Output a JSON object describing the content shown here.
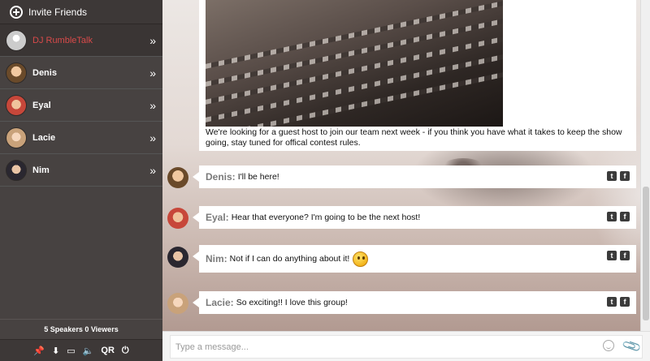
{
  "sidebar": {
    "invite_label": "Invite Friends",
    "users": [
      {
        "name": "DJ RumbleTalk",
        "active": true,
        "avatar_color": "#dcdcdc"
      },
      {
        "name": "Denis",
        "active": false,
        "avatar_color": "#d9a066"
      },
      {
        "name": "Eyal",
        "active": false,
        "avatar_color": "#cf5a45"
      },
      {
        "name": "Lacie",
        "active": false,
        "avatar_color": "#e4c3a0"
      },
      {
        "name": "Nim",
        "active": false,
        "avatar_color": "#2c2a2e"
      }
    ],
    "chevron": "»",
    "status": "5 Speakers 0 Viewers",
    "tools": [
      {
        "name": "pin-icon",
        "glyph": "📌"
      },
      {
        "name": "download-icon",
        "glyph": "⬇"
      },
      {
        "name": "window-icon",
        "glyph": "▭"
      },
      {
        "name": "volume-icon",
        "glyph": "🔈"
      },
      {
        "name": "qr-icon",
        "glyph": "QR"
      },
      {
        "name": "power-icon",
        "glyph": "⏻"
      }
    ]
  },
  "post": {
    "text": "We're looking for a guest host to join our team next week - if you think you have what it takes to keep the show going, stay tuned for offical contest rules."
  },
  "messages": [
    {
      "user": "Denis:",
      "text": "I'll be here!",
      "avatar_color": "#d9a066",
      "emoji": false
    },
    {
      "user": "Eyal:",
      "text": "Hear that everyone? I'm going to be the next host!",
      "avatar_color": "#cf5a45",
      "emoji": false
    },
    {
      "user": "Nim:",
      "text": "Not if I can do anything about it!",
      "avatar_color": "#2c2a2e",
      "emoji": true
    },
    {
      "user": "Lacie:",
      "text": "So exciting!! I love this group!",
      "avatar_color": "#e4c3a0",
      "emoji": false
    }
  ],
  "share": {
    "twitter": "t",
    "facebook": "f"
  },
  "input": {
    "placeholder": "Type a message..."
  }
}
